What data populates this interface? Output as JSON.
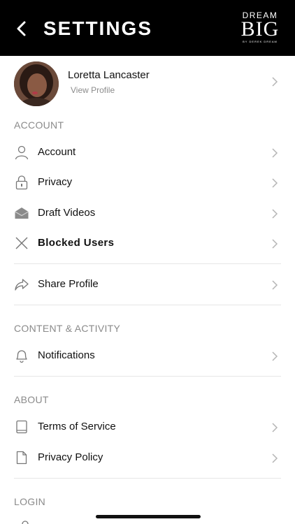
{
  "header": {
    "title": "SETTINGS",
    "logo": {
      "line1": "DREAM",
      "line2": "BIG",
      "line3": "BY DEREK DREAM"
    }
  },
  "profile": {
    "name": "Loretta Lancaster",
    "link": "View Profile"
  },
  "sections": {
    "account": "ACCOUNT",
    "content": "CONTENT & ACTIVITY",
    "about": "ABOUT",
    "login": "LOGIN"
  },
  "items": {
    "account": "Account",
    "privacy": "Privacy",
    "drafts": "Draft Videos",
    "blocked": "Blocked Users",
    "share": "Share Profile",
    "notifications": "Notifications",
    "terms": "Terms of Service",
    "policy": "Privacy Policy"
  },
  "colors": {
    "header_bg": "#000000",
    "section_text": "#8a8a8a",
    "divider": "#e6e6e6"
  }
}
